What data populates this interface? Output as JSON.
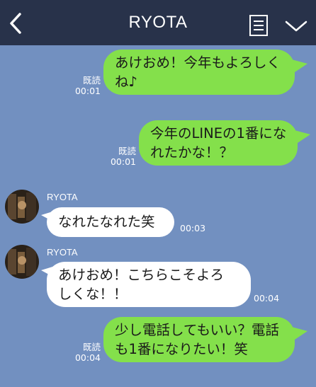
{
  "header": {
    "back_icon": "chevron-left-icon",
    "title": "RYOTA",
    "menu_icon": "document-menu-icon",
    "dropdown_icon": "chevron-down-icon"
  },
  "colors": {
    "background": "#7290c0",
    "header": "#28324a",
    "my_bubble": "#84e04b",
    "their_bubble": "#ffffff"
  },
  "messages": [
    {
      "sender": "me",
      "lines": [
        "あけおめ！今年もよろしく",
        "ね♪"
      ],
      "read": "既読",
      "time": "00:01"
    },
    {
      "sender": "me",
      "lines": [
        "今年のLINEの1番にな",
        "れたかな！？"
      ],
      "read": "既読",
      "time": "00:01"
    },
    {
      "sender": "RYOTA",
      "lines": [
        "なれたなれた笑"
      ],
      "time": "00:03"
    },
    {
      "sender": "RYOTA",
      "lines": [
        "あけおめ！こちらこそよろ",
        "しくな！！"
      ],
      "time": "00:04"
    },
    {
      "sender": "me",
      "lines": [
        "少し電話してもいい？電話",
        "も1番になりたい！笑"
      ],
      "read": "既読",
      "time": "00:04"
    }
  ]
}
